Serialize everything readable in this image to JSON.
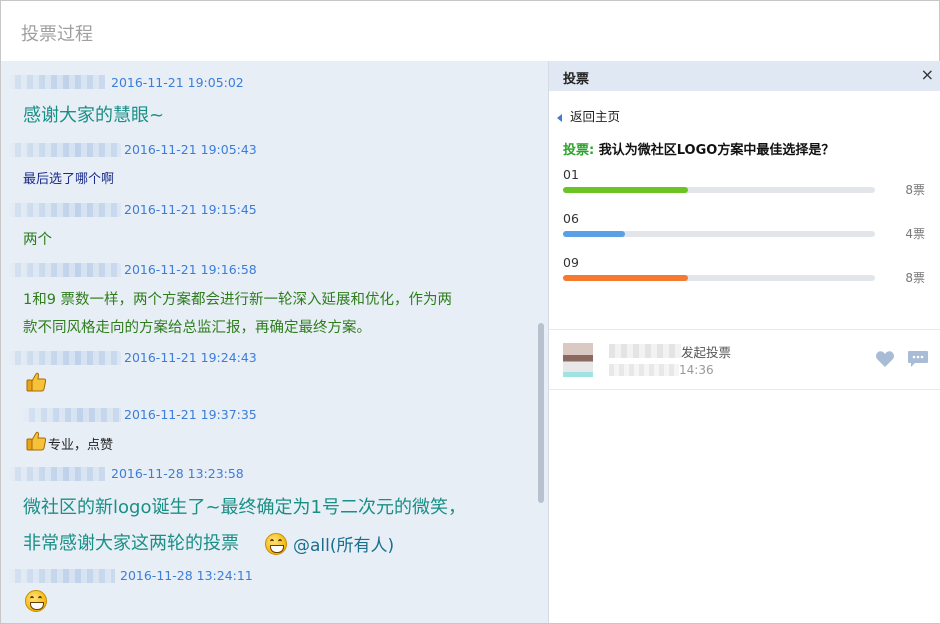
{
  "window": {
    "title": "投票过程"
  },
  "chat": {
    "messages": [
      {
        "time": "2016-11-21 19:05:02",
        "text": "感谢大家的慧眼~",
        "style": "teal-big"
      },
      {
        "time": "2016-11-21 19:05:43",
        "text": "最后选了哪个啊",
        "style": "navy"
      },
      {
        "time": "2016-11-21 19:15:45",
        "text": "两个",
        "style": "green"
      },
      {
        "time": "2016-11-21 19:16:58",
        "lines": [
          "1和9 票数一样，两个方案都会进行新一轮深入延展和优化，作为两",
          "款不同风格走向的方案给总监汇报，再确定最终方案。"
        ],
        "style": "green"
      },
      {
        "time": "2016-11-21 19:24:43",
        "emoji": "thumbs-up"
      },
      {
        "time": "2016-11-21 19:37:35",
        "emoji": "thumbs-up",
        "text": "专业，点赞"
      },
      {
        "time": "2016-11-28 13:23:58",
        "lines": [
          "微社区的新logo诞生了~最终确定为1号二次元的微笑，",
          "非常感谢大家这两轮的投票"
        ],
        "mention": "@all(所有人)",
        "emoji": "grin"
      },
      {
        "time": "2016-11-28 13:24:11",
        "emoji": "grin"
      }
    ]
  },
  "vote_panel": {
    "title": "投票",
    "close": "×",
    "back_label": "返回主页",
    "question_label": "投票:",
    "question_text": "我认为微社区LOGO方案中最佳选择是？",
    "options": [
      {
        "name": "01",
        "votes": 8,
        "count_label": "8票",
        "color": "#6cc324"
      },
      {
        "name": "06",
        "votes": 4,
        "count_label": "4票",
        "color": "#5aa0e6"
      },
      {
        "name": "09",
        "votes": 8,
        "count_label": "8票",
        "color": "#f57a30"
      }
    ],
    "max_votes": 8,
    "creator": {
      "action": "发起投票",
      "time": "14:36"
    }
  }
}
